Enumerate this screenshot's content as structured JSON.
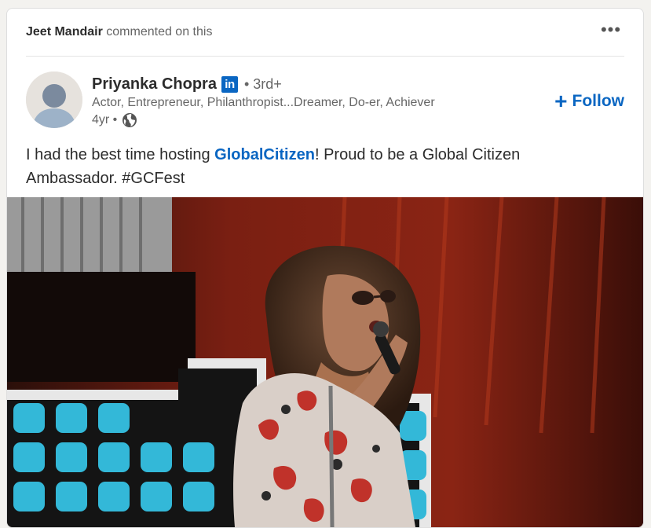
{
  "context": {
    "actor": "Jeet Mandair",
    "action": "commented on this",
    "more_label": "•••"
  },
  "author": {
    "name": "Priyanka Chopra",
    "badge": "in",
    "degree": "• 3rd+",
    "headline": "Actor, Entrepreneur, Philanthropist...Dreamer, Do-er, Achiever",
    "time": "4yr •",
    "visibility_icon": "globe-icon"
  },
  "follow": {
    "plus": "+",
    "label": "Follow"
  },
  "post": {
    "text_before": "I had the best time hosting ",
    "mention": "GlobalCitizen",
    "text_after": "! Proud to be a Global Citizen Ambassador. #GCFest"
  },
  "colors": {
    "accent": "#0a66c2",
    "text_primary": "#2c2c2c",
    "text_secondary": "#666666",
    "background": "#f3f2ef"
  }
}
